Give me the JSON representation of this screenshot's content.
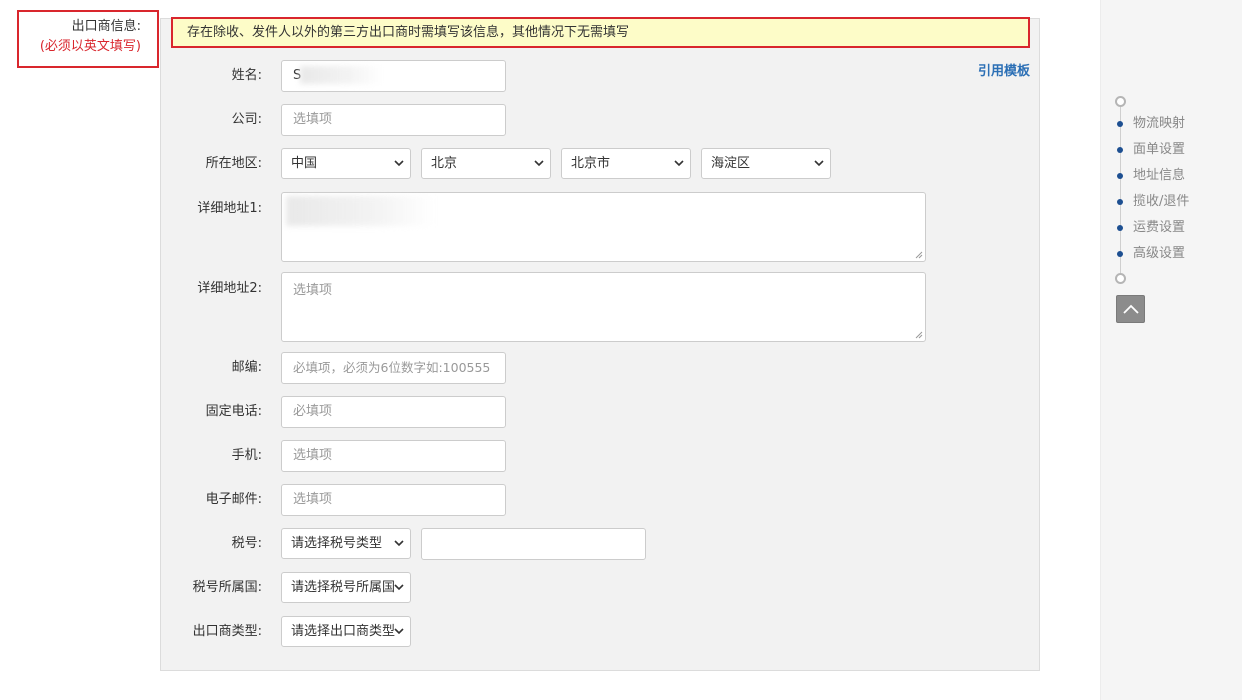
{
  "section": {
    "title": "出口商信息:",
    "note": "(必须以英文填写)"
  },
  "notice": "存在除收、发件人以外的第三方出口商时需填写该信息，其他情况下无需填写",
  "template_link": "引用模板",
  "fields": {
    "name": {
      "label": "姓名:",
      "value": "S"
    },
    "company": {
      "label": "公司:",
      "placeholder": "选填项"
    },
    "region": {
      "label": "所在地区:",
      "country": "中国",
      "province": "北京",
      "city": "北京市",
      "district": "海淀区"
    },
    "address1": {
      "label": "详细地址1:"
    },
    "address2": {
      "label": "详细地址2:",
      "placeholder": "选填项"
    },
    "postcode": {
      "label": "邮编:",
      "placeholder": "必填项，必须为6位数字如:100555"
    },
    "phone": {
      "label": "固定电话:",
      "placeholder": "必填项"
    },
    "mobile": {
      "label": "手机:",
      "placeholder": "选填项"
    },
    "email": {
      "label": "电子邮件:",
      "placeholder": "选填项"
    },
    "tax_no": {
      "label": "税号:",
      "type_select": "请选择税号类型",
      "value": ""
    },
    "tax_country": {
      "label": "税号所属国:",
      "select": "请选择税号所属国"
    },
    "exporter_type": {
      "label": "出口商类型:",
      "select": "请选择出口商类型"
    }
  },
  "side_nav": {
    "items": [
      "物流映射",
      "面单设置",
      "地址信息",
      "揽收/退件",
      "运费设置",
      "高级设置"
    ],
    "dot_color": "#1d4f91"
  },
  "colors": {
    "highlight_border": "#d9262d",
    "link": "#2b6fb5",
    "notice_bg": "#fdfcc8"
  }
}
